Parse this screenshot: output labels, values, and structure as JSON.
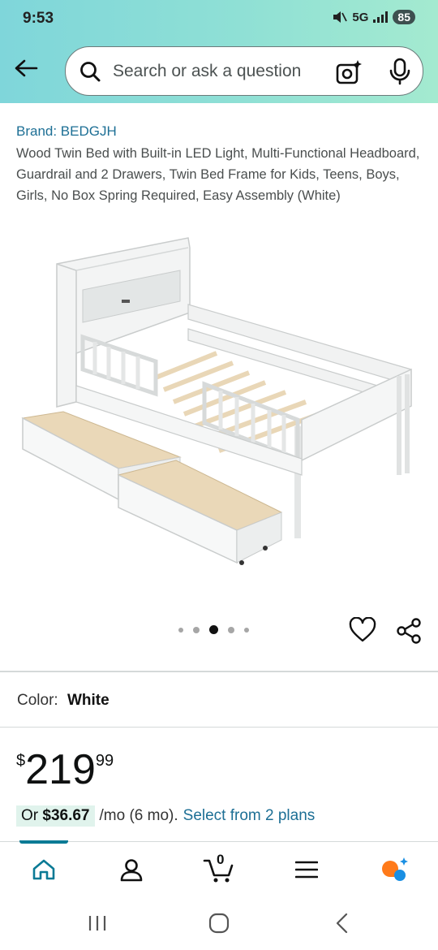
{
  "status": {
    "time": "9:53",
    "network": "5G",
    "battery": "85"
  },
  "search": {
    "placeholder": "Search or ask a question"
  },
  "product": {
    "brand": "Brand: BEDGJH",
    "title": "Wood Twin Bed with Built-in LED Light, Multi-Functional Headboard, Guardrail and 2 Drawers, Twin Bed Frame for Kids, Teens, Boys, Girls, No Box Spring Required, Easy Assembly (White)",
    "image_dots": 5,
    "active_dot": 3
  },
  "color": {
    "label": "Color:",
    "value": "White"
  },
  "price": {
    "currency": "$",
    "whole": "219",
    "fraction": "99"
  },
  "plan": {
    "prefix": "Or",
    "amount": "$36.67",
    "term": "/mo (6 mo).",
    "link": "Select from 2 plans"
  },
  "nav": {
    "items": [
      "home-icon",
      "account-icon",
      "cart-icon",
      "menu-icon",
      "rufus-icon"
    ],
    "cart_count": "0"
  },
  "colors": {
    "accent": "#0a7a95",
    "link": "#1d6f95",
    "plan_badge": "#e0f3ec"
  }
}
